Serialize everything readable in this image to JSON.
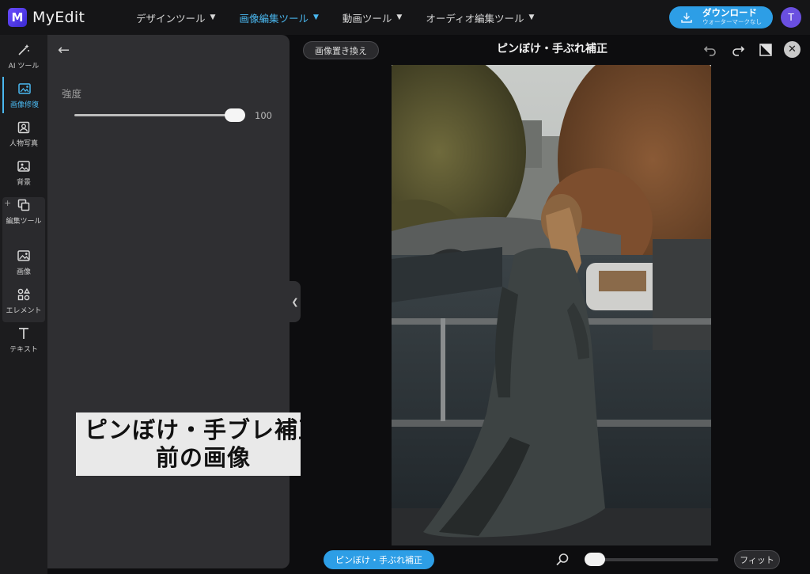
{
  "app": {
    "name": "MyEdit",
    "logo_letter": "M"
  },
  "nav": [
    {
      "label": "デザインツール",
      "active": false
    },
    {
      "label": "画像編集ツール",
      "active": true
    },
    {
      "label": "動画ツール",
      "active": false
    },
    {
      "label": "オーディオ編集ツール",
      "active": false
    }
  ],
  "download": {
    "label": "ダウンロード",
    "sublabel": "ウォーターマークなし"
  },
  "user": {
    "avatar_letter": "T"
  },
  "rail": [
    {
      "label": "AI ツール",
      "icon": "magic-wand-icon",
      "active": false
    },
    {
      "label": "画像修復",
      "icon": "image-repair-icon",
      "active": true
    },
    {
      "label": "人物写真",
      "icon": "portrait-icon",
      "active": false
    },
    {
      "label": "背景",
      "icon": "background-icon",
      "active": false
    },
    {
      "label": "編集ツール",
      "icon": "edit-tools-icon",
      "active": false
    },
    {
      "label": "画像",
      "icon": "image-icon",
      "active": false
    },
    {
      "label": "エレメント",
      "icon": "elements-icon",
      "active": false
    },
    {
      "label": "テキスト",
      "icon": "text-icon",
      "active": false
    }
  ],
  "panel": {
    "strength_label": "強度",
    "strength_value": "100",
    "strength_fraction": 1.0
  },
  "caption": {
    "line1": "ピンぼけ・手ブレ補正",
    "line2": "前の画像"
  },
  "canvas": {
    "replace_label": "画像置き換え",
    "title": "ピンぼけ・手ぶれ補正",
    "bottom_label": "ピンぼけ・手ぶれ補正",
    "fit_label": "フィット",
    "zoom_fraction": 0.0
  },
  "colors": {
    "accent": "#2d9ee6",
    "active_text": "#4ab8f0",
    "avatar": "#6a4fe0"
  }
}
